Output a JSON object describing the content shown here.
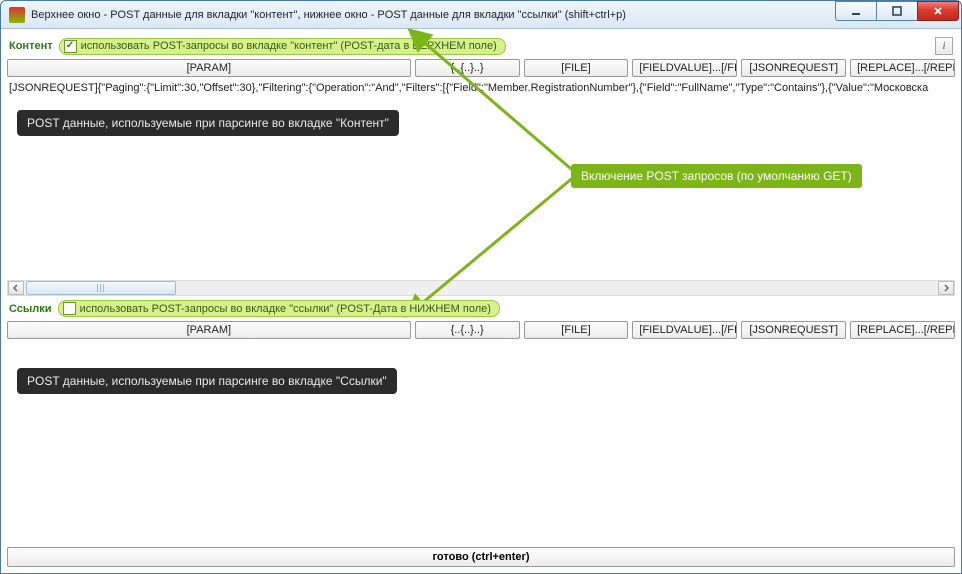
{
  "title": "Верхнее окно - POST данные для вкладки \"контент\", нижнее окно - POST данные для вкладки \"ссылки\" (shift+ctrl+p)",
  "top": {
    "section_label": "Контент",
    "checkbox_label": "использовать POST-запросы во вкладке \"контент\" (POST-дата в ВЕРХНЕМ поле)",
    "checkbox_checked": true,
    "info_label": "i",
    "buttons": {
      "param": "[PARAM]",
      "braces": "{..{..}..}",
      "file": "[FILE]",
      "fieldvalue": "[FIELDVALUE]...[/FIELDVALUE]",
      "jsonrequest": "[JSONREQUEST]",
      "replace": "[REPLACE]...[/REPLACE]"
    },
    "body_text": "[JSONREQUEST]{\"Paging\":{\"Limit\":30,\"Offset\":30},\"Filtering\":{\"Operation\":\"And\",\"Filters\":[{\"Field\":\"Member.RegistrationNumber\"},{\"Field\":\"FullName\",\"Type\":\"Contains\"},{\"Value\":\"Московска",
    "callout": "POST данные, используемые при парсинге во вкладке \"Контент\"",
    "green_callout": "Включение POST запросов (по умолчанию GET)"
  },
  "bottom": {
    "section_label": "Ссылки",
    "checkbox_label": "использовать POST-запросы во вкладке \"ссылки\" (POST-Дата в НИЖНЕМ поле)",
    "checkbox_checked": false,
    "buttons": {
      "param": "[PARAM]",
      "braces": "{..{..}..}",
      "file": "[FILE]",
      "fieldvalue": "[FIELDVALUE]...[/FIELDVALUE]",
      "jsonrequest": "[JSONREQUEST]",
      "replace": "[REPLACE]...[/REPLACE]"
    },
    "callout": "POST данные, используемые при парсинге во вкладке \"Ссылки\""
  },
  "status_button": "готово (ctrl+enter)"
}
